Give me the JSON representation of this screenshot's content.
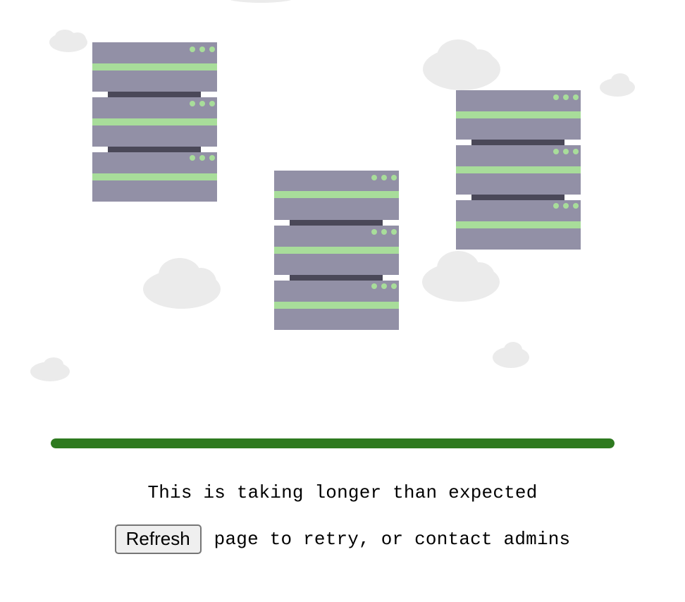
{
  "illustration": {
    "server_body_color": "#9290a6",
    "server_stripe_color": "#a8dd9a",
    "server_connector_color": "#4a4858",
    "cloud_color": "#ebebeb"
  },
  "progress": {
    "fraction": 1.0,
    "color": "#2e7a1f"
  },
  "status": {
    "message": "This is taking longer than expected",
    "refresh_button_label": "Refresh",
    "retry_text": "page to retry, or contact admins"
  }
}
